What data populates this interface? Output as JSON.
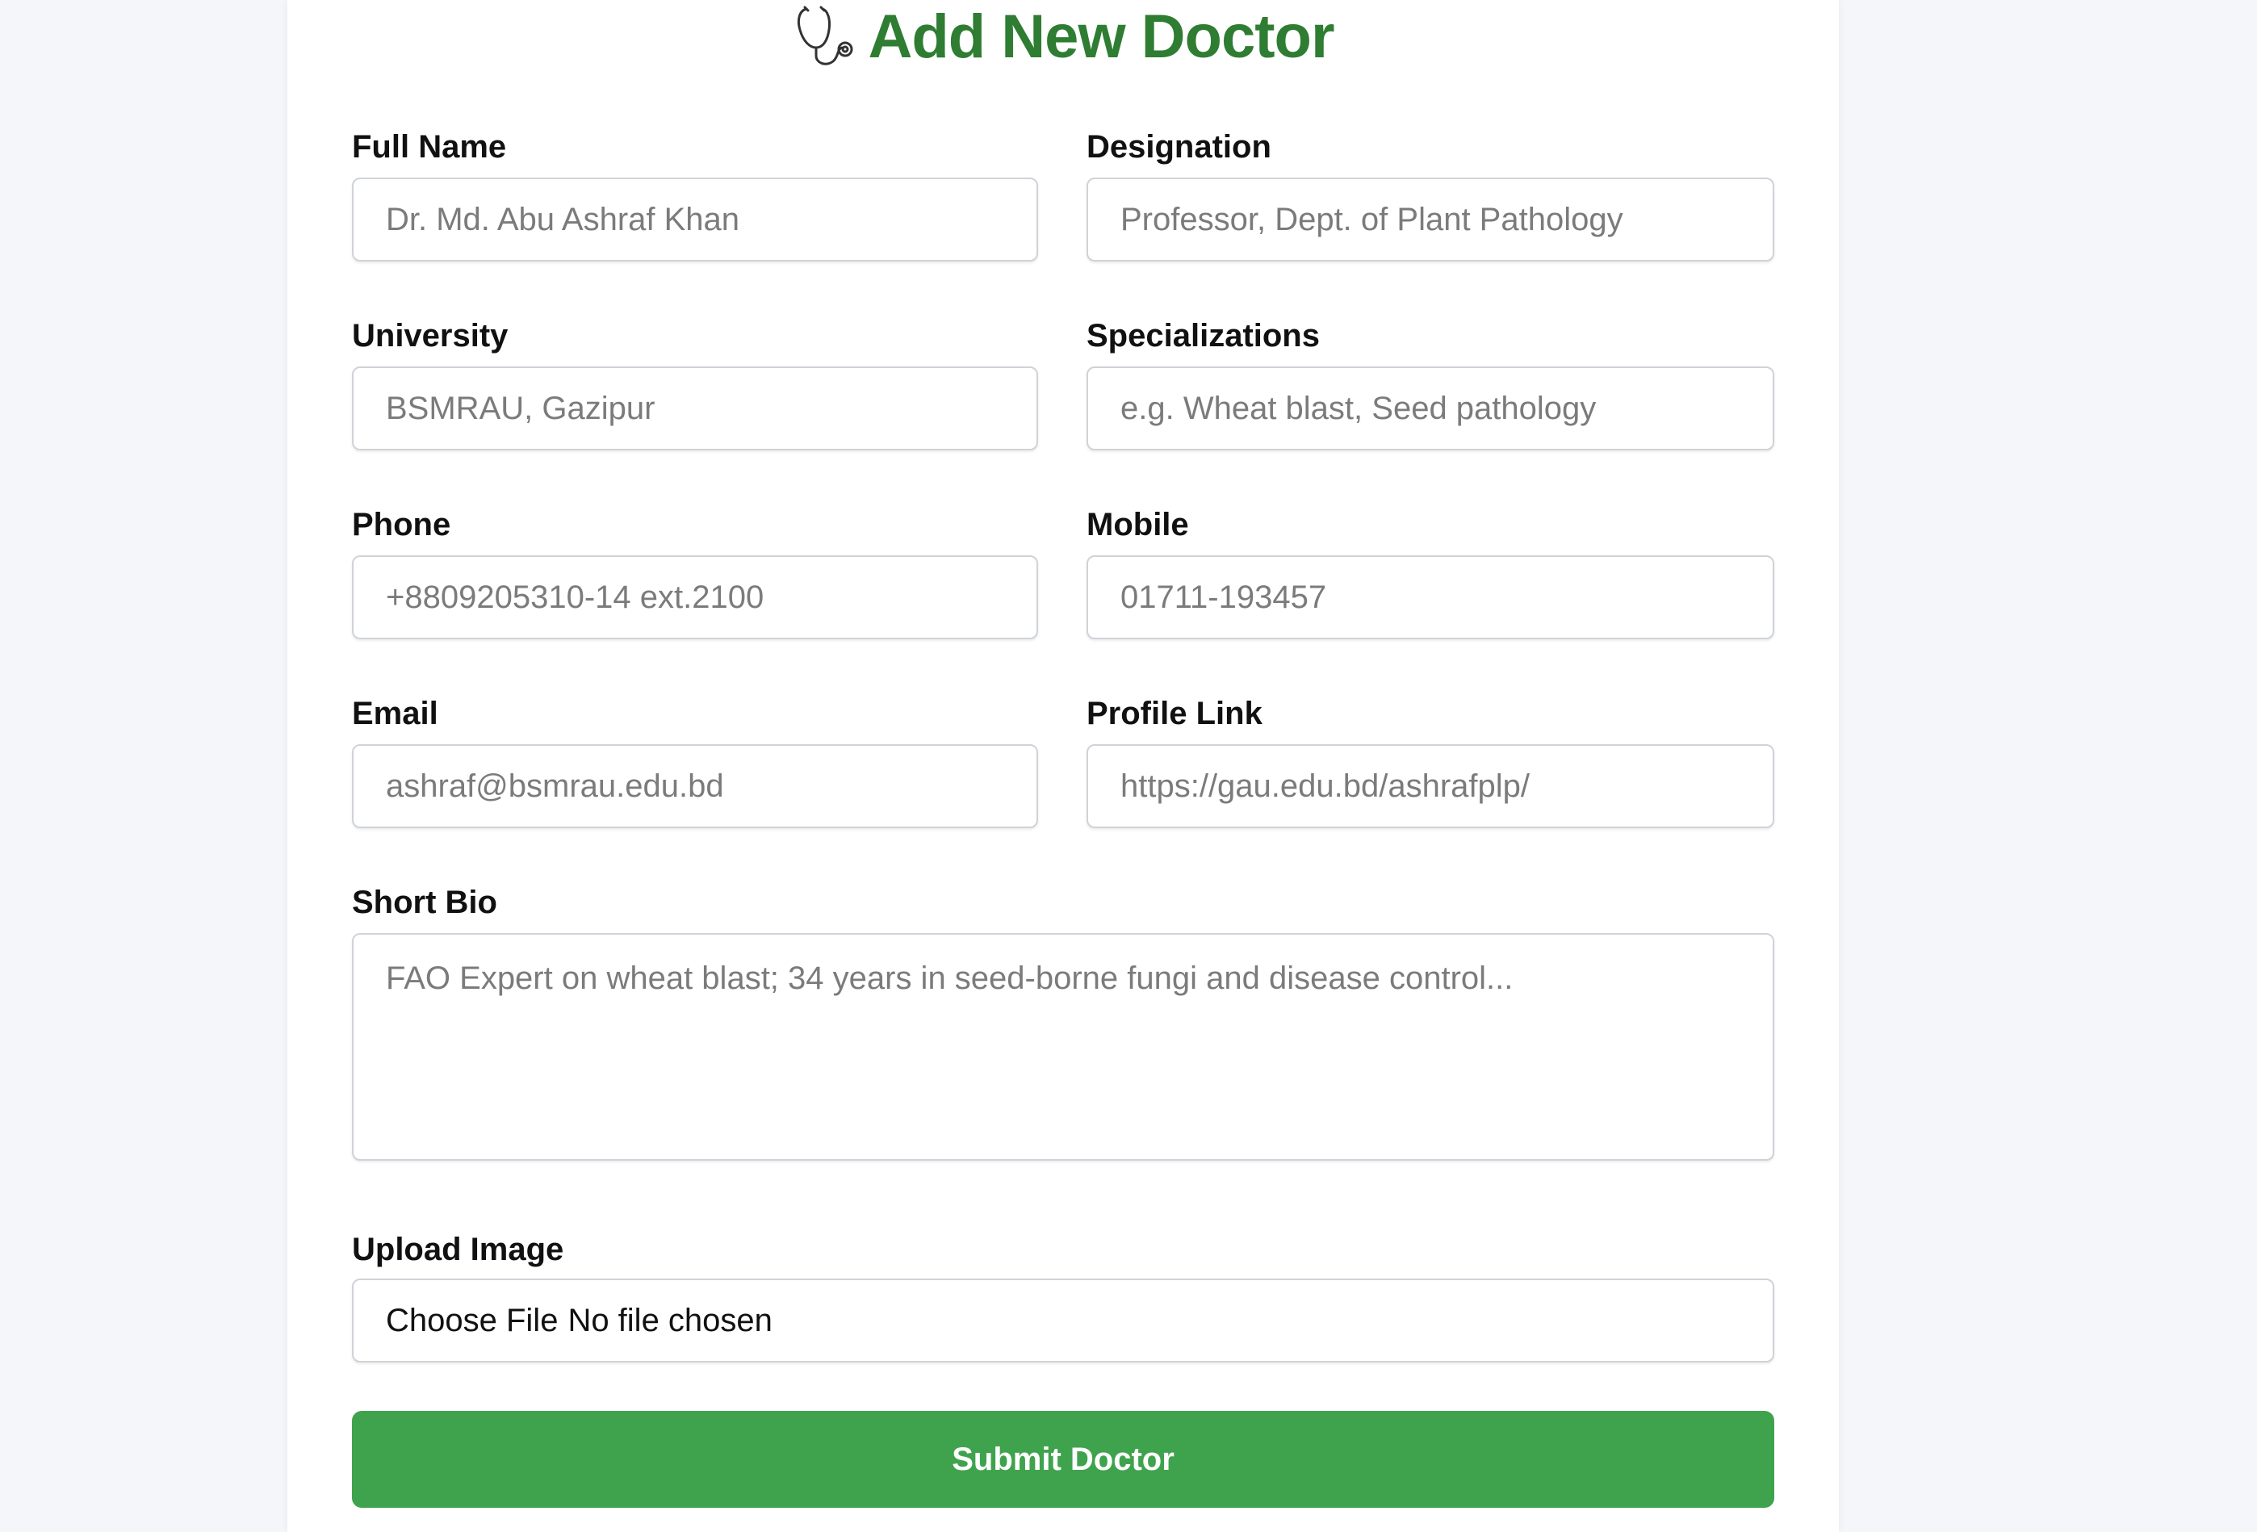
{
  "form": {
    "title": "Add New Doctor",
    "title_icon": "stethoscope-icon",
    "accent_color": "#2e7d32",
    "button_color": "#3fa34d",
    "fields": {
      "full_name": {
        "label": "Full Name",
        "placeholder": "Dr. Md. Abu Ashraf Khan"
      },
      "designation": {
        "label": "Designation",
        "placeholder": "Professor, Dept. of Plant Pathology"
      },
      "university": {
        "label": "University",
        "placeholder": "BSMRAU, Gazipur"
      },
      "specializations": {
        "label": "Specializations",
        "placeholder": "e.g. Wheat blast, Seed pathology"
      },
      "phone": {
        "label": "Phone",
        "placeholder": "+8809205310-14 ext.2100"
      },
      "mobile": {
        "label": "Mobile",
        "placeholder": "01711-193457"
      },
      "email": {
        "label": "Email",
        "placeholder": "ashraf@bsmrau.edu.bd"
      },
      "profile_link": {
        "label": "Profile Link",
        "placeholder": "https://gau.edu.bd/ashrafplp/"
      },
      "short_bio": {
        "label": "Short Bio",
        "placeholder": "FAO Expert on wheat blast; 34 years in seed-borne fungi and disease control..."
      },
      "upload_image": {
        "label": "Upload Image",
        "button_label": "Choose File",
        "status": "No file chosen"
      }
    },
    "submit_label": "Submit Doctor"
  }
}
